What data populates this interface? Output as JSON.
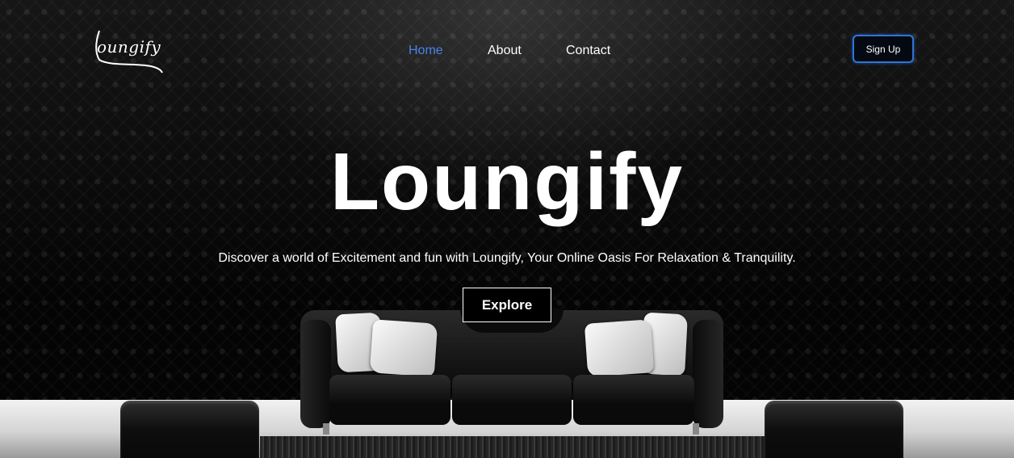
{
  "brand": {
    "logo_text": "oungify"
  },
  "nav": {
    "items": [
      {
        "label": "Home",
        "active": true
      },
      {
        "label": "About",
        "active": false
      },
      {
        "label": "Contact",
        "active": false
      }
    ]
  },
  "header": {
    "signup_label": "Sign Up"
  },
  "hero": {
    "title": "Loungify",
    "tagline": "Discover a world of Excitement and fun with Loungify, Your Online Oasis For Relaxation & Tranquility.",
    "cta_label": "Explore"
  },
  "colors": {
    "active_link": "#4a82e8",
    "signup_border": "#2f74d8",
    "background": "#000000",
    "text": "#ffffff"
  }
}
